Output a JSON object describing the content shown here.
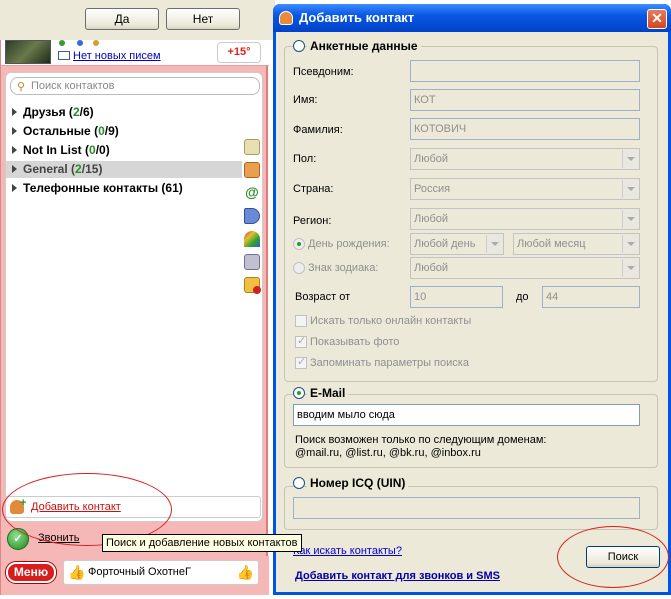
{
  "confirm": {
    "yes_label": "Да",
    "no_label": "Нет"
  },
  "agent": {
    "mail_status": "Нет новых писем",
    "temperature": "+15°",
    "search_placeholder": "Поиск контактов",
    "groups": [
      {
        "name": "Друзья",
        "count_open": "2",
        "count_total": "6"
      },
      {
        "name": "Остальные",
        "count_open": "0",
        "count_total": "9"
      },
      {
        "name": "Not In List",
        "count_open": "0",
        "count_total": "0"
      },
      {
        "name": "General",
        "count_open": "2",
        "count_total": "15"
      },
      {
        "name": "Телефонные контакты",
        "count_text": "(61)"
      }
    ],
    "side_icons": [
      "sms-icon",
      "contacts-book-icon",
      "email-at-icon",
      "speaker-icon",
      "rainbow-icon",
      "tools-icon",
      "folder-icon"
    ],
    "add_contact_label": "Добавить контакт",
    "call_label": "Звонить",
    "menu_label": "Меню",
    "status_text": "Форточный ОхотнеГ",
    "tooltip": "Поиск и добавление новых контактов"
  },
  "dialog": {
    "title": "Добавить контакт",
    "close": "✕",
    "profile_section": "Анкетные данные",
    "fields": {
      "nickname_label": "Псевдоним:",
      "nickname_value": "",
      "firstname_label": "Имя:",
      "firstname_value": "КОТ",
      "lastname_label": "Фамилия:",
      "lastname_value": "КОТОВИЧ",
      "gender_label": "Пол:",
      "gender_value": "Любой",
      "country_label": "Страна:",
      "country_value": "Россия",
      "region_label": "Регион:",
      "region_value": "Любой",
      "birthday_label": "День рождения:",
      "birthday_day": "Любой день",
      "birthday_month": "Любой месяц",
      "zodiac_label": "Знак зодиака:",
      "zodiac_value": "Любой",
      "age_from_label": "Возраст от",
      "age_from_value": "10",
      "age_to_label": "до",
      "age_to_value": "44"
    },
    "checks": {
      "online_only": "Искать только онлайн контакты",
      "show_photo": "Показывать фото",
      "remember": "Запоминать параметры поиска"
    },
    "email_section": "E-Mail",
    "email_value": "вводим мыло сюда",
    "email_note_line1": "Поиск возможен только по следующим доменам:",
    "email_note_line2": "@mail.ru, @list.ru, @bk.ru, @inbox.ru",
    "icq_section": "Номер ICQ (UIN)",
    "icq_value": "",
    "howto_link": "Как искать контакты?",
    "add_phone_link": "Добавить контакт для звонков и SMS",
    "search_button": "Поиск"
  }
}
